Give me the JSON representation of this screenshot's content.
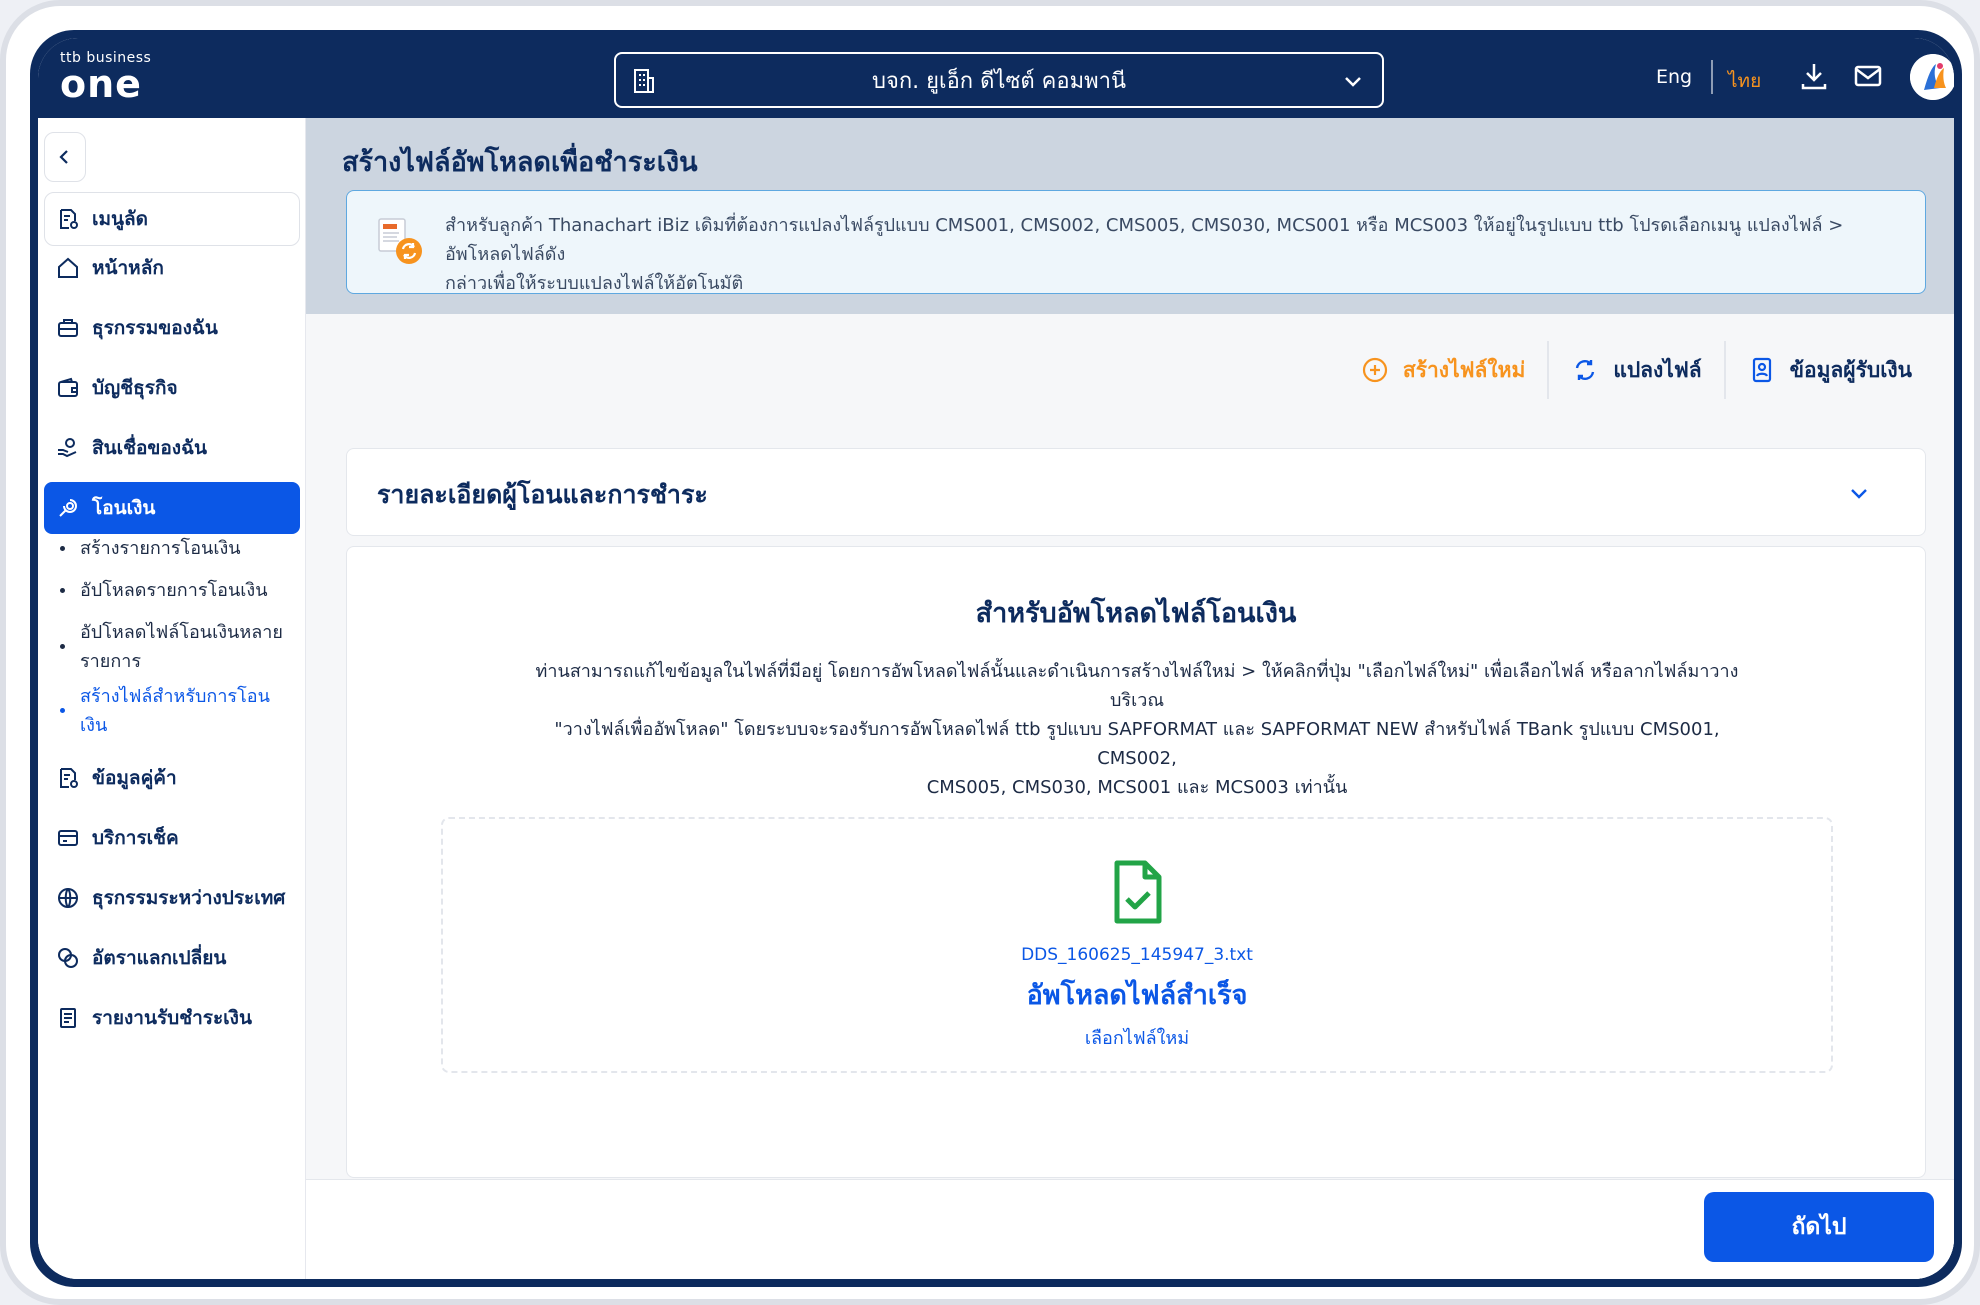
{
  "header": {
    "logo_small": "ttb business",
    "logo_big": "one",
    "company_name": "บจก. ยูเอ็ก ดีไซต์ คอมพานี",
    "lang_en": "Eng",
    "lang_th": "ไทย"
  },
  "sidebar": {
    "menu_label": "เมนูลัด",
    "items": [
      {
        "label": "หน้าหลัก",
        "icon": "home-icon"
      },
      {
        "label": "ธุรกรรมของฉัน",
        "icon": "briefcase-icon"
      },
      {
        "label": "บัญชีธุรกิจ",
        "icon": "wallet-icon"
      },
      {
        "label": "สินเชื่อของฉัน",
        "icon": "loan-icon"
      },
      {
        "label": "โอนเงิน",
        "icon": "transfer-icon"
      },
      {
        "label": "ข้อมูลคู่ค้า",
        "icon": "partner-icon"
      },
      {
        "label": "บริการเช็ค",
        "icon": "cheque-icon"
      },
      {
        "label": "ธุรกรรมระหว่างประเทศ",
        "icon": "globe-icon"
      },
      {
        "label": "อัตราแลกเปลี่ยน",
        "icon": "exchange-icon"
      },
      {
        "label": "รายงานรับชำระเงิน",
        "icon": "report-icon"
      }
    ],
    "sub_items": [
      "สร้างรายการโอนเงิน",
      "อัปโหลดรายการโอนเงิน",
      "อัปโหลดไฟล์โอนเงินหลาย",
      "รายการ",
      "สร้างไฟล์สำหรับการโอน",
      "เงิน"
    ]
  },
  "main": {
    "page_title": "สร้างไฟล์อัพโหลดเพื่อชำระเงิน",
    "info_line1": "สำหรับลูกค้า Thanachart iBiz เดิมที่ต้องการแปลงไฟล์รูปแบบ CMS001, CMS002, CMS005, CMS030, MCS001 หรือ MCS003 ให้อยู่ในรูปแบบ ttb โปรดเลือกเมนู แปลงไฟล์ > อัพโหลดไฟล์ดัง",
    "info_line2": "กล่าวเพื่อให้ระบบแปลงไฟล์ให้อัตโนมัติ",
    "toolbar": {
      "create_new": "สร้างไฟล์ใหม่",
      "convert": "แปลงไฟล์",
      "payee_info": "ข้อมูลผู้รับเงิน"
    },
    "accordion_title": "รายละเอียดผู้โอนและการชำระ",
    "upload": {
      "title": "สำหรับอัพโหลดไฟล์โอนเงิน",
      "desc_line1": "ท่านสามารถแก้ไขข้อมูลในไฟล์ที่มีอยู่ โดยการอัพโหลดไฟล์นั้นและดำเนินการสร้างไฟล์ใหม่ > ให้คลิกที่ปุ่ม \"เลือกไฟล์ใหม่\" เพื่อเลือกไฟล์ หรือลากไฟล์มาวางบริเวณ",
      "desc_line2": "\"วางไฟล์เพื่ออัพโหลด\" โดยระบบจะรองรับการอัพโหลดไฟล์ ttb รูปแบบ SAPFORMAT และ SAPFORMAT NEW สำหรับไฟล์ TBank รูปแบบ CMS001, CMS002,",
      "desc_line3": "CMS005, CMS030, MCS001 และ MCS003 เท่านั้น",
      "file_name": "DDS_160625_145947_3.txt",
      "status": "อัพโหลดไฟล์สำเร็จ",
      "choose_new": "เลือกไฟล์ใหม่"
    },
    "next_label": "ถัดไป"
  },
  "colors": {
    "navy": "#0d2b5e",
    "primary_blue": "#0b57e6",
    "orange": "#f7931e",
    "success_green": "#22a447"
  }
}
